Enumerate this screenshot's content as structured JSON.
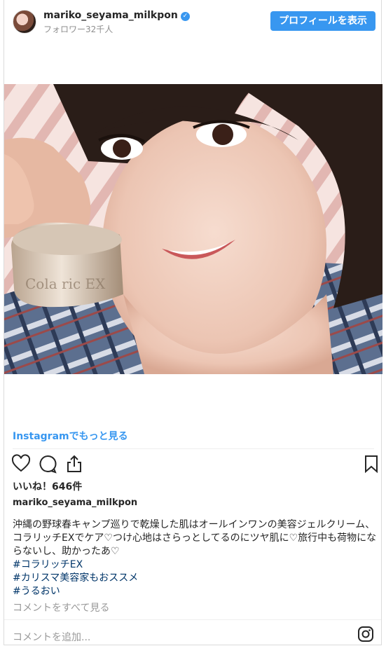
{
  "header": {
    "username": "mariko_seyama_milkpon",
    "followers": "フォロワー32千人",
    "profile_button": "プロフィールを表示"
  },
  "post": {
    "more_link": "Instagramでもっと見る",
    "likes": "いいね！646件",
    "author": "mariko_seyama_milkpon",
    "caption_lines": [
      "沖縄の野球春キャンプ巡りで乾燥した肌はオールインワンの美容ジェルクリーム、",
      "コラリッチEXでケア♡つけ心地はさらっとしてるのにツヤ肌に♡旅行中も荷物にな",
      "らないし、助かったあ♡"
    ],
    "hashtags": [
      "#コラリッチEX",
      "#カリスマ美容家もおススメ",
      "#うるおい"
    ],
    "view_comments": "コメントをすべて見る",
    "add_comment": "コメントを追加..."
  },
  "icons": {
    "verified": "verified-badge-icon",
    "like": "heart-icon",
    "comment": "comment-icon",
    "share": "share-icon",
    "save": "bookmark-icon",
    "instagram": "instagram-icon"
  },
  "colors": {
    "accent": "#3897f0",
    "hashtag": "#003569",
    "muted": "#999999"
  }
}
